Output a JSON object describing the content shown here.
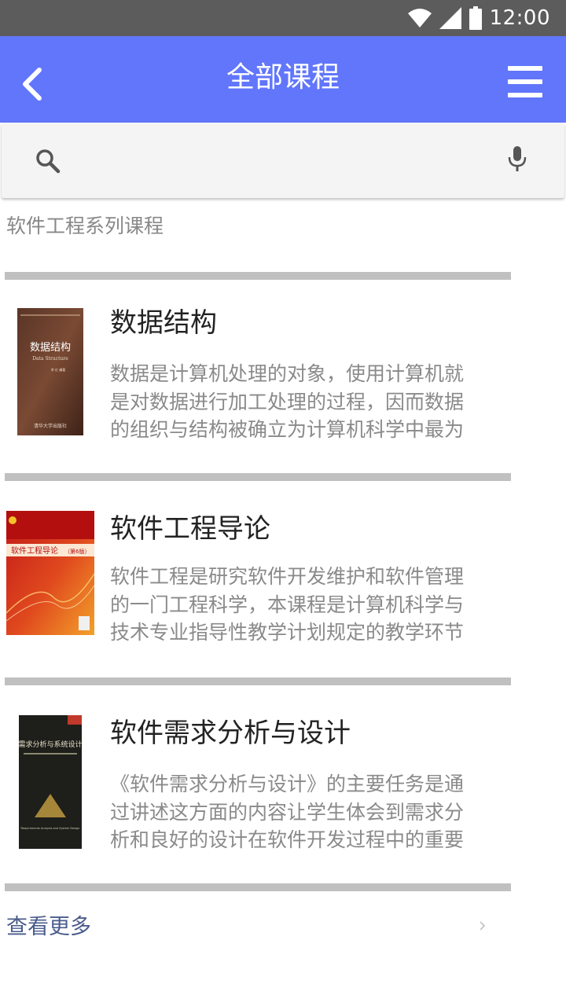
{
  "status_bar": {
    "time": "12:00",
    "icons": [
      "wifi-icon",
      "signal-icon",
      "battery-icon"
    ]
  },
  "app_bar": {
    "title": "全部课程",
    "back_icon": "back-arrow-icon",
    "menu_icon": "hamburger-menu-icon"
  },
  "search": {
    "value": "",
    "placeholder": "",
    "search_icon": "search-icon",
    "mic_icon": "mic-icon"
  },
  "section": {
    "title": "软件工程系列课程"
  },
  "courses": [
    {
      "title": "数据结构",
      "description": "数据是计算机处理的对象，使用计算机就是对数据进行加工处理的过程，因而数据的组织与结构被确立为计算机科学中最为",
      "cover": {
        "title": "数据结构",
        "subtitle": "Data Structure",
        "author": "李 红 编著",
        "publisher": "清华大学出版社"
      }
    },
    {
      "title": "软件工程导论",
      "description": "软件工程是研究软件开发维护和软件管理的一门工程科学，本课程是计算机科学与技术专业指导性教学计划规定的教学环节",
      "cover": {
        "title": "软件工程导论",
        "edition": "（第6版）"
      }
    },
    {
      "title": "软件需求分析与设计",
      "description": "《软件需求分析与设计》的主要任务是通过讲述这方面的内容让学生体会到需求分析和良好的设计在软件开发过程中的重要",
      "cover": {
        "title": "需求分析与系统设计",
        "subtitle": "Requirements Analysis and System Design"
      }
    }
  ],
  "more": {
    "label": "查看更多",
    "icon": "chevron-right-icon"
  },
  "colors": {
    "app_bar": "#6176fb",
    "status_bar": "#5c5c5c",
    "divider": "#c0c0c0",
    "link": "#4a5c8c"
  }
}
